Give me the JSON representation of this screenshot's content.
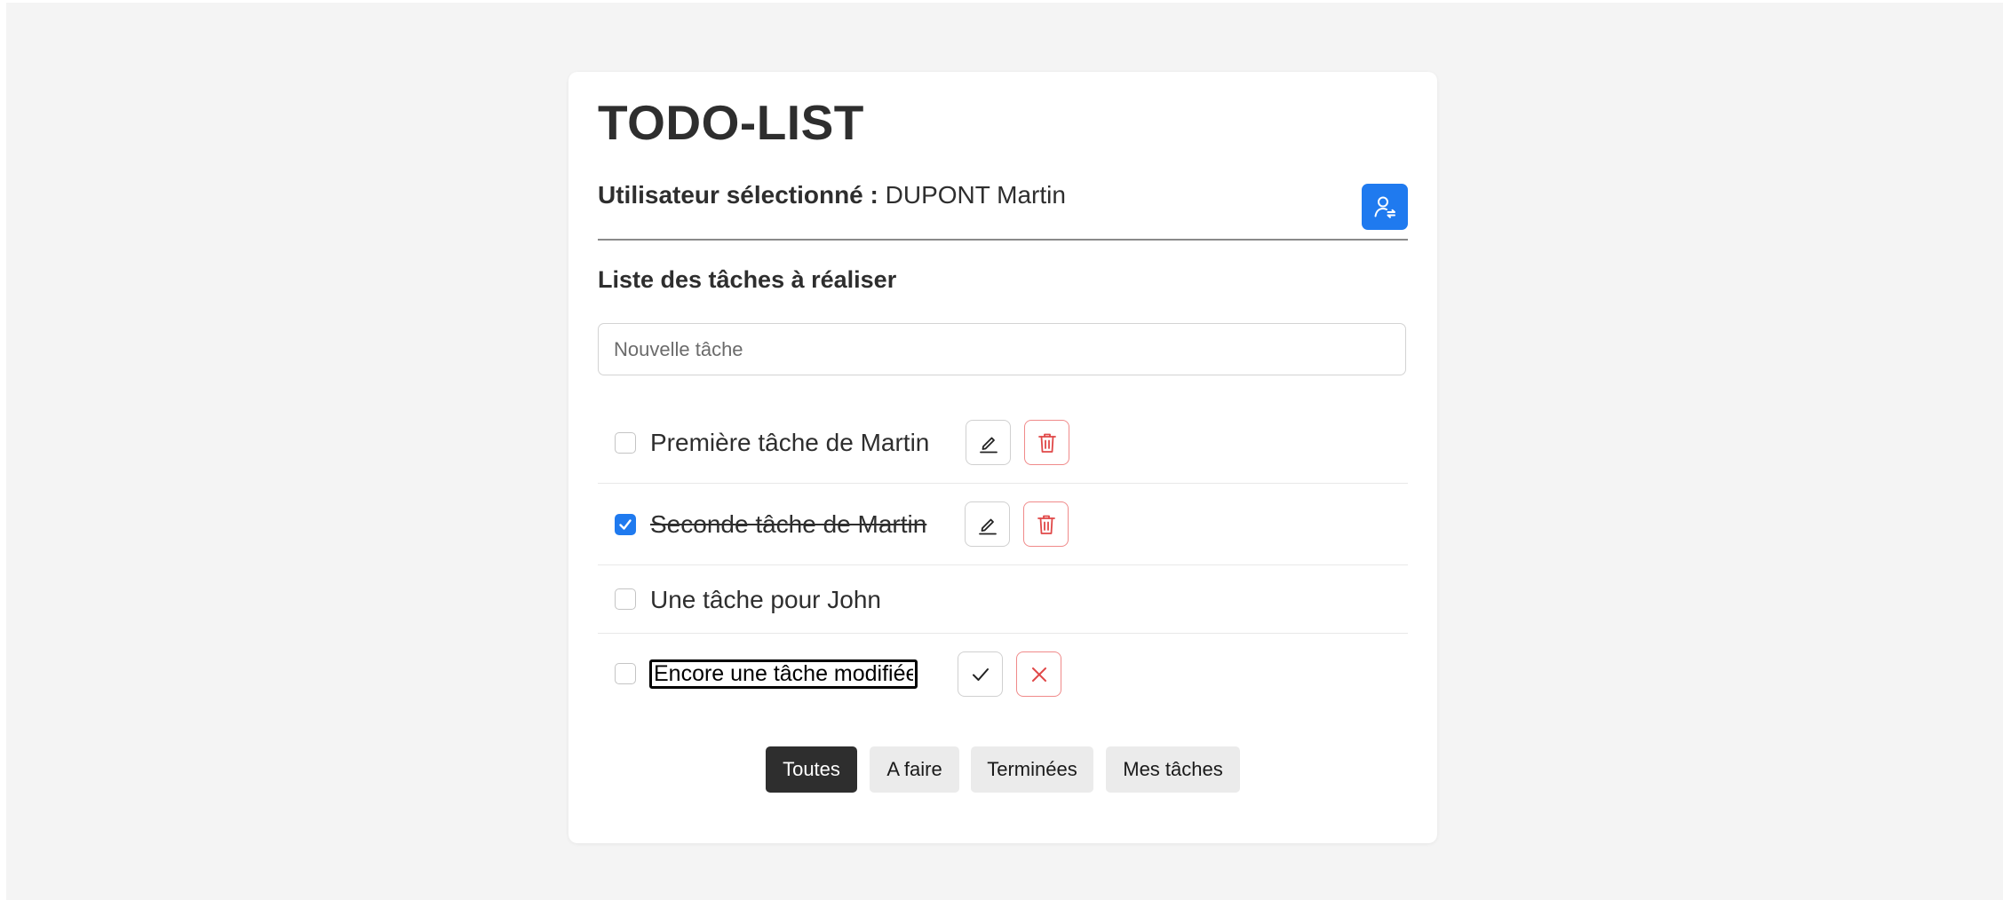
{
  "app": {
    "title": "TODO-LIST"
  },
  "user": {
    "label": "Utilisateur sélectionné :",
    "name": "DUPONT Martin",
    "switch_icon": "user-switch-icon"
  },
  "tasks_section": {
    "title": "Liste des tâches à réaliser",
    "new_task_placeholder": "Nouvelle tâche",
    "new_task_value": ""
  },
  "tasks": [
    {
      "label": "Première tâche de Martin",
      "checked": false,
      "state": "view",
      "actions": [
        "edit-icon",
        "trash-icon"
      ]
    },
    {
      "label": "Seconde tâche de Martin",
      "checked": true,
      "state": "view",
      "actions": [
        "edit-icon",
        "trash-icon"
      ]
    },
    {
      "label": "Une tâche pour John",
      "checked": false,
      "state": "view",
      "actions": []
    },
    {
      "label": "Encore une tâche modifiée",
      "checked": false,
      "state": "editing",
      "actions": [
        "check-icon",
        "close-icon"
      ]
    }
  ],
  "filters": {
    "items": [
      "Toutes",
      "A faire",
      "Terminées",
      "Mes tâches"
    ],
    "active": "Toutes"
  },
  "colors": {
    "accent": "#1f7aef",
    "danger": "#f08a8a",
    "active_filter": "#2e2e2e",
    "page_background": "#f4f4f4"
  }
}
